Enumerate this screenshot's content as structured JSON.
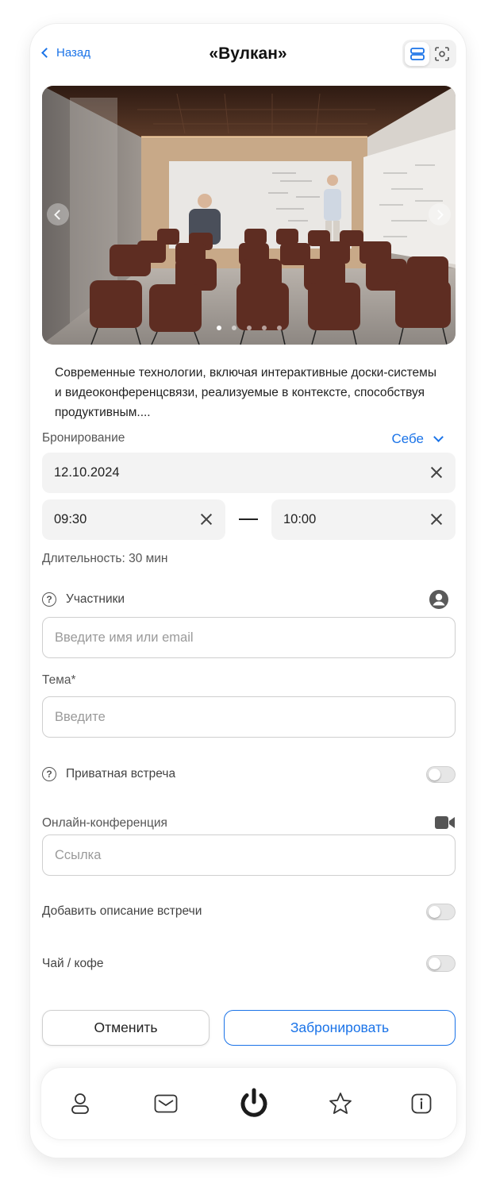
{
  "header": {
    "back_label": "Назад",
    "title": "«Вулкан»"
  },
  "gallery": {
    "total_slides": 5,
    "active_index": 0
  },
  "room": {
    "description": "Современные технологии, включая интерактивные доски-системы и видеоконференцсвязи, реализуемые в контексте, способствуя продуктивным...."
  },
  "booking": {
    "label": "Бронирование",
    "for_whom": "Себе",
    "date": "12.10.2024",
    "time_from": "09:30",
    "time_to": "10:00",
    "duration": "Длительность: 30 мин"
  },
  "participants": {
    "label": "Участники",
    "placeholder": "Введите имя или email"
  },
  "topic": {
    "label": "Тема*",
    "placeholder": "Введите"
  },
  "private_meeting": {
    "label": "Приватная встреча",
    "enabled": false
  },
  "online_conference": {
    "label": "Онлайн-конференция",
    "placeholder": "Ссылка"
  },
  "add_description": {
    "label": "Добавить описание встречи",
    "enabled": false
  },
  "tea_coffee": {
    "label": "Чай / кофе",
    "enabled": false
  },
  "actions": {
    "cancel": "Отменить",
    "book": "Забронировать"
  },
  "colors": {
    "accent": "#1a73e8",
    "field_bg": "#f3f3f3",
    "chair": "#5e2d22"
  },
  "tabbar": {
    "items": [
      "user-icon",
      "mail-icon",
      "power-icon",
      "star-icon",
      "info-icon"
    ]
  }
}
